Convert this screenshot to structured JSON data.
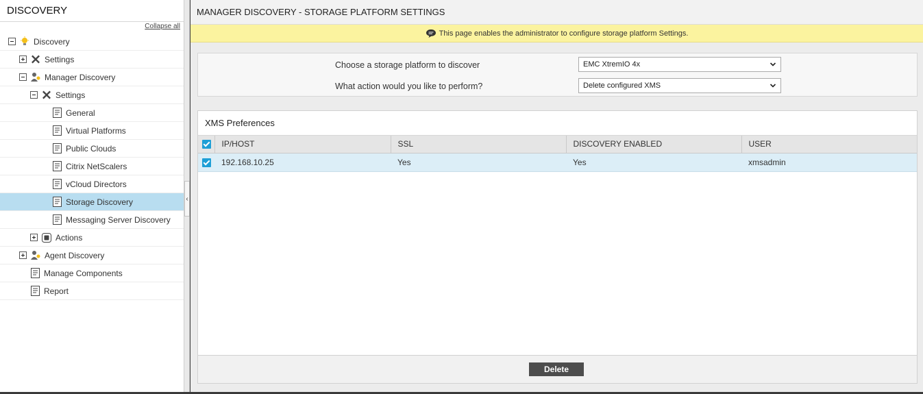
{
  "sidebar": {
    "title": "DISCOVERY",
    "collapse_all": "Collapse all",
    "items": [
      {
        "label": "Discovery"
      },
      {
        "label": "Settings"
      },
      {
        "label": "Manager Discovery"
      },
      {
        "label": "Settings"
      },
      {
        "label": "General"
      },
      {
        "label": "Virtual Platforms"
      },
      {
        "label": "Public Clouds"
      },
      {
        "label": "Citrix NetScalers"
      },
      {
        "label": "vCloud Directors"
      },
      {
        "label": "Storage Discovery"
      },
      {
        "label": "Messaging Server Discovery"
      },
      {
        "label": "Actions"
      },
      {
        "label": "Agent Discovery"
      },
      {
        "label": "Manage Components"
      },
      {
        "label": "Report"
      }
    ]
  },
  "main": {
    "title": "MANAGER DISCOVERY - STORAGE PLATFORM SETTINGS",
    "banner": "This page enables the administrator to configure storage platform Settings.",
    "form": {
      "platform_label": "Choose a storage platform to discover",
      "platform_value": "EMC XtremIO 4x",
      "action_label": "What action would you like to perform?",
      "action_value": "Delete configured XMS"
    },
    "grid": {
      "caption": "XMS Preferences",
      "columns": [
        "IP/HOST",
        "SSL",
        "DISCOVERY ENABLED",
        "USER"
      ],
      "rows": [
        {
          "host": "192.168.10.25",
          "ssl": "Yes",
          "discovery_enabled": "Yes",
          "user": "xmsadmin"
        }
      ]
    },
    "delete_label": "Delete"
  },
  "colors": {
    "selected_row": "#b8ddf0",
    "banner": "#fbf39f",
    "checkbox": "#1e9fd6",
    "grid_row": "#dceef7"
  }
}
